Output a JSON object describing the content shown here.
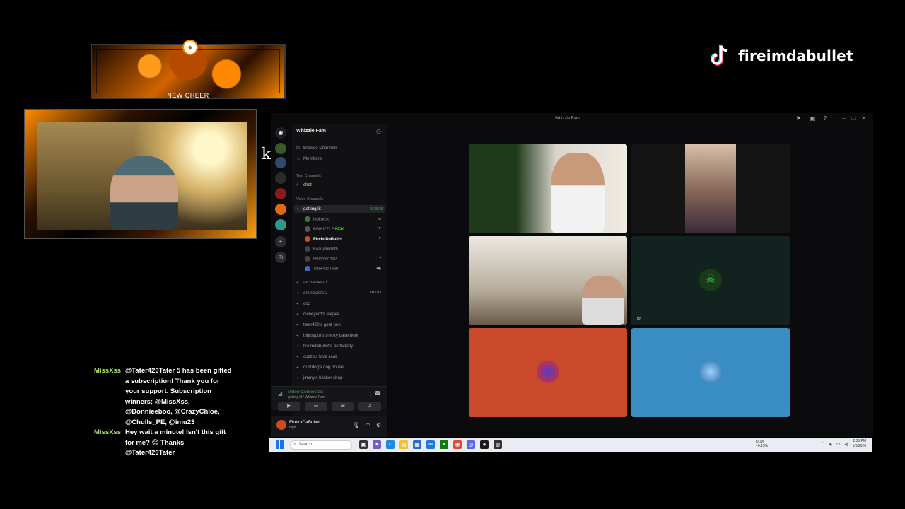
{
  "brand": {
    "name": "fireimdabullet",
    "logo_icon": "tiktok-icon"
  },
  "cheer": {
    "label": "NEW CHEER"
  },
  "overlay_text": "kicks!",
  "chat": {
    "messages": [
      {
        "user": "MissXss",
        "text": "@Tater420Tater 5 has been gifted a subscription! Thank you for your support. Subscription winners; @MissXss, @Donnieeboo, @CrazyChloe, @Chulls_PE, @imu23"
      },
      {
        "user": "MissXss",
        "text": "Hey wait a minute! Isn't this gift for me? 😊 Thanks @Tater420Tater"
      }
    ]
  },
  "discord": {
    "window_title": "Whizzle Fam",
    "guild_name": "Whizzle Fam",
    "browse_channels": "Browse Channels",
    "members": "Members",
    "text_channels_header": "Text Channels",
    "text_channels": [
      "chat"
    ],
    "voice_channels_header": "Voice Channels",
    "active_channel": {
      "name": "getting lit",
      "timer": "5:18:08"
    },
    "voice_members": [
      {
        "name": "bigkrypto"
      },
      {
        "name": "BWHIZZLE",
        "badge": "KICK"
      },
      {
        "name": "FireImDaBullet"
      },
      {
        "name": "KazuyaWrath"
      },
      {
        "name": "Rustman420"
      },
      {
        "name": "Tater420Tater"
      }
    ],
    "voice_channels": [
      {
        "name": "arc raiders 1"
      },
      {
        "name": "arc raiders 2",
        "count": "00 / 03"
      },
      {
        "name": "cod"
      },
      {
        "name": "cvineyard's teepee"
      },
      {
        "name": "tater420's goat pen"
      },
      {
        "name": "bigkrypto's smoky basement"
      },
      {
        "name": "fireimdabullet's portapotty"
      },
      {
        "name": "cuzzo's love seat"
      },
      {
        "name": "dustdog's dog house"
      },
      {
        "name": "jimmy's blinker shop"
      }
    ],
    "voice_connected": {
      "title": "Video Connected",
      "subtitle": "getting lit / Whizzle Fam"
    },
    "user": {
      "name": "FireImDaBullet",
      "status": "high"
    }
  },
  "taskbar": {
    "search_placeholder": "Search",
    "stock": {
      "name": "DOW",
      "change": "+0.13%"
    },
    "time": "2:35 PM",
    "date": "1/8/2026"
  }
}
